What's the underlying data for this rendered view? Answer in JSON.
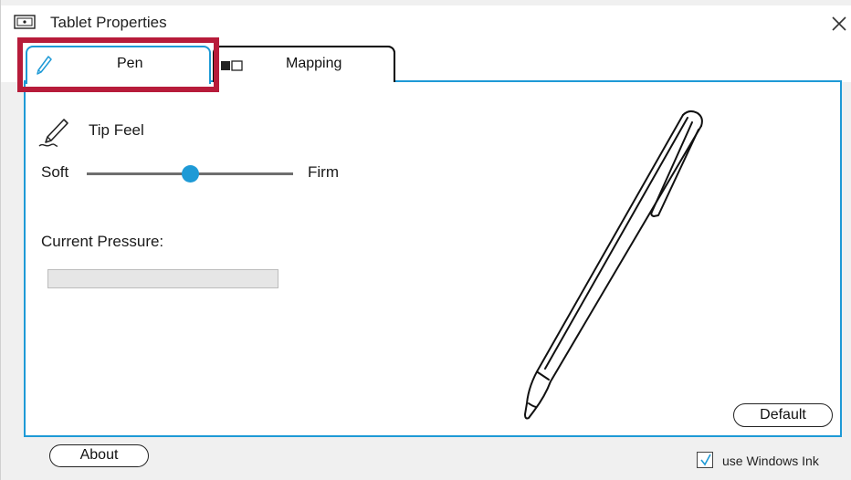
{
  "window": {
    "title": "Tablet Properties",
    "app_icon": "tablet-icon",
    "close_icon": "close-icon"
  },
  "tabs": [
    {
      "label": "Pen",
      "icon": "pen-icon",
      "selected": true
    },
    {
      "label": "Mapping",
      "icon": "screen-mapping-icon",
      "selected": false
    }
  ],
  "pen_tab": {
    "tip_feel": {
      "icon": "pen-nib-icon",
      "label": "Tip Feel",
      "min_label": "Soft",
      "max_label": "Firm",
      "value_fraction": 0.5
    },
    "current_pressure": {
      "label": "Current Pressure:",
      "value_fraction": 0
    },
    "default_button": "Default"
  },
  "footer": {
    "about_button": "About",
    "use_windows_ink": {
      "label": "use Windows Ink",
      "checked": true
    }
  },
  "colors": {
    "accent": "#1e9ad6",
    "highlight_annotation": "#b71c3a"
  }
}
